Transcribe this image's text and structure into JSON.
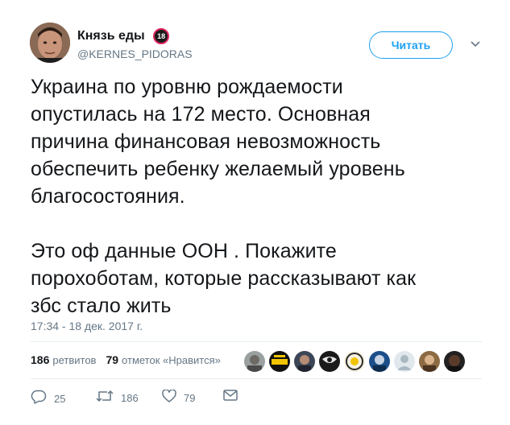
{
  "user": {
    "display_name": "Князь еды",
    "badge": "18",
    "handle": "@KERNES_PIDORAS"
  },
  "follow_button": {
    "label": "Читать"
  },
  "tweet": {
    "text_paragraph_1": "Украина по уровню рождаемости\nопустилась на 172 место. Основная\nпричина финансовая невозможность\nобеспечить ребенку желаемый уровень\nблагосостояния.",
    "text_paragraph_2": "Это оф данные ООН . Покажите\nпорохоботам, которые рассказывают как\nзбс стало жить",
    "timestamp": "17:34 - 18 дек. 2017 г."
  },
  "stats": {
    "retweets_count": "186",
    "retweets_label": "ретвитов",
    "likes_count": "79",
    "likes_label": "отметок «Нравится»"
  },
  "actions": {
    "reply_count": "25",
    "retweet_count": "186",
    "like_count": "79"
  },
  "colors": {
    "accent": "#1da1f2",
    "text": "#14171a",
    "muted": "#657786",
    "divider": "#e6ecf0"
  }
}
